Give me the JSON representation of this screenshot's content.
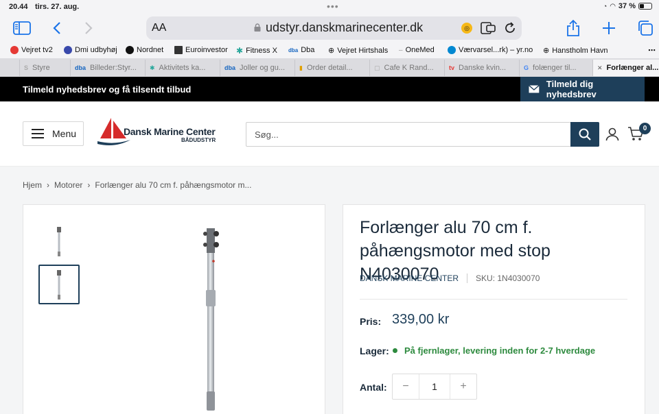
{
  "status": {
    "time": "20.44",
    "date": "tirs. 27. aug.",
    "battery": "37 %"
  },
  "browser": {
    "aa_label": "AA",
    "url": "udstyr.danskmarinecenter.dk",
    "favorites": [
      {
        "label": "Vejret tv2",
        "color": "#e53935"
      },
      {
        "label": "Dmi udbyhøj",
        "color": "#3949ab"
      },
      {
        "label": "Nordnet",
        "color": "#111111"
      },
      {
        "label": "Euroinvestor",
        "color": "#333333"
      },
      {
        "label": "Fitness X",
        "color": "#26a69a"
      },
      {
        "label": "Dba",
        "color": "#1565c0"
      },
      {
        "label": "Vejret Hirtshals",
        "color": "#222222"
      },
      {
        "label": "OneMed",
        "color": "#999999"
      },
      {
        "label": "Værvarsel...rk) – yr.no",
        "color": "#0288d1"
      },
      {
        "label": "Hanstholm Havn",
        "color": "#222222"
      }
    ],
    "tabs": [
      {
        "label": "Styre",
        "icon": "S"
      },
      {
        "label": "Billeder:Styr...",
        "icon": "dba"
      },
      {
        "label": "Aktivitets ka...",
        "icon": "✱"
      },
      {
        "label": "Joller og gu...",
        "icon": "dba"
      },
      {
        "label": "Order detail...",
        "icon": "▮"
      },
      {
        "label": "Cafe K Rand...",
        "icon": "▢"
      },
      {
        "label": "Danske kvin...",
        "icon": "tv"
      },
      {
        "label": "folænger til...",
        "icon": "G"
      },
      {
        "label": "Forlænger al...",
        "icon": "✕"
      }
    ]
  },
  "site": {
    "announcement": "Tilmeld nyhedsbrev og få tilsendt tilbud",
    "newsletter_button": "Tilmeld dig nyhedsbrev",
    "menu_label": "Menu",
    "logo_name": "Dansk Marine Center",
    "logo_sub": "BÅDUDSTYR",
    "search_placeholder": "Søg...",
    "cart_count": "0"
  },
  "breadcrumb": [
    "Hjem",
    "Motorer",
    "Forlænger alu 70 cm f. påhængsmotor m..."
  ],
  "product": {
    "title": "Forlænger alu 70 cm f. påhængsmotor med stop N4030070",
    "vendor": "DANSK MARINE CENTER",
    "sku": "SKU: 1N4030070",
    "price_label": "Pris:",
    "price": "339,00 kr",
    "stock_label": "Lager:",
    "stock_text": "På fjernlager, levering inden for 2-7 hverdage",
    "qty_label": "Antal:",
    "qty_value": "1",
    "qty_minus": "−",
    "qty_plus": "+"
  },
  "colors": {
    "primary": "#1e3f5a",
    "stock_green": "#2d8a3e",
    "browser_blue": "#1a73e8"
  }
}
